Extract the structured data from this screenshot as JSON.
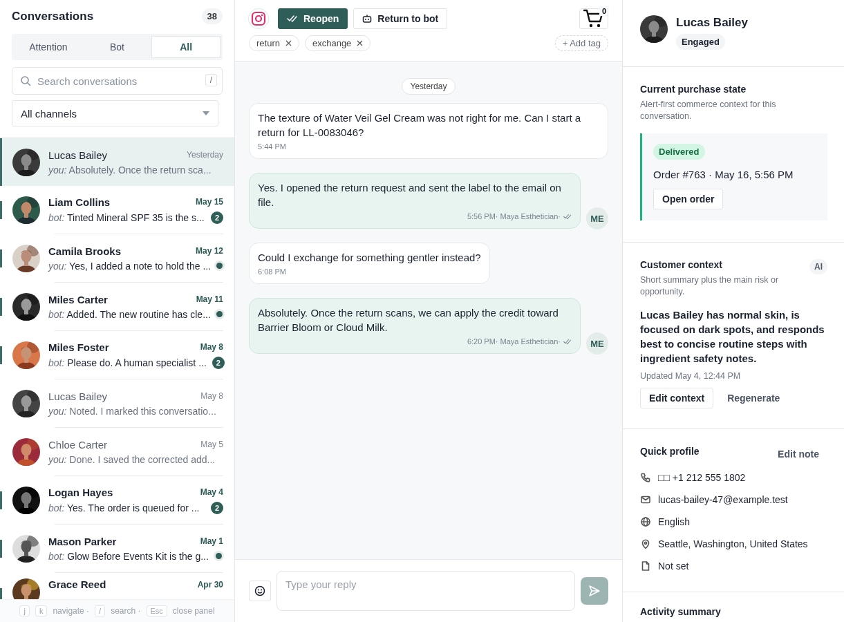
{
  "sidebar": {
    "title": "Conversations",
    "count": "38",
    "tabs": [
      {
        "label": "Attention",
        "selected": false
      },
      {
        "label": "Bot",
        "selected": false
      },
      {
        "label": "All",
        "selected": true
      }
    ],
    "search": {
      "placeholder": "Search conversations",
      "shortcut": "/"
    },
    "channel_filter": {
      "value": "All channels"
    },
    "conversations": [
      {
        "name": "Lucas Bailey",
        "date": "Yesterday",
        "sender": "you:",
        "preview": "Absolutely. Once the return sca...",
        "unread": false,
        "selected": true
      },
      {
        "name": "Liam Collins",
        "date": "May 15",
        "sender": "bot:",
        "preview": "Tinted Mineral SPF 35 is the s...",
        "unread": true,
        "selected": false,
        "indicator": {
          "kind": "count",
          "text": "2"
        }
      },
      {
        "name": "Camila Brooks",
        "date": "May 12",
        "sender": "you:",
        "preview": "Yes, I added a note to hold the ...",
        "unread": true,
        "selected": false,
        "indicator": {
          "kind": "dot"
        }
      },
      {
        "name": "Miles Carter",
        "date": "May 11",
        "sender": "bot:",
        "preview": "Added. The new routine has cle...",
        "unread": true,
        "selected": false,
        "indicator": {
          "kind": "dot"
        }
      },
      {
        "name": "Miles Foster",
        "date": "May 8",
        "sender": "bot:",
        "preview": "Please do. A human specialist ...",
        "unread": true,
        "selected": false,
        "indicator": {
          "kind": "count",
          "text": "2"
        }
      },
      {
        "name": "Lucas Bailey",
        "date": "May 8",
        "sender": "you:",
        "preview": "Noted. I marked this conversatio...",
        "unread": false,
        "selected": false
      },
      {
        "name": "Chloe Carter",
        "date": "May 5",
        "sender": "you:",
        "preview": "Done. I saved the corrected add...",
        "unread": false,
        "selected": false
      },
      {
        "name": "Logan Hayes",
        "date": "May 4",
        "sender": "bot:",
        "preview": "Yes. The order is queued for ...",
        "unread": true,
        "selected": false,
        "indicator": {
          "kind": "count",
          "text": "2"
        }
      },
      {
        "name": "Mason Parker",
        "date": "May 1",
        "sender": "bot:",
        "preview": "Glow Before Events Kit is the g...",
        "unread": true,
        "selected": false,
        "indicator": {
          "kind": "dot"
        }
      },
      {
        "name": "Grace Reed",
        "date": "Apr 30",
        "unread": true,
        "selected": false
      }
    ],
    "shortcuts": [
      {
        "kind": "key",
        "text": "j"
      },
      {
        "kind": "key",
        "text": "k"
      },
      {
        "kind": "label",
        "text": "navigate ·"
      },
      {
        "kind": "key",
        "text": "/"
      },
      {
        "kind": "label",
        "text": "search ·"
      },
      {
        "kind": "key",
        "text": "Esc"
      },
      {
        "kind": "label",
        "text": "close panel"
      }
    ]
  },
  "conversation": {
    "actions": [
      {
        "label": "Reopen",
        "kind": "primary"
      },
      {
        "label": "Return to bot",
        "kind": "secondary"
      }
    ],
    "cart_count": "0",
    "tags": [
      "return",
      "exchange"
    ],
    "add_tag": "+ Add tag",
    "day_separator": "Yesterday",
    "messages": [
      {
        "kind": "inbound",
        "text": "The texture of Water Veil Gel Cream was not right for me. Can I start a return for LL-0083046?",
        "time": "5:44 PM"
      },
      {
        "kind": "outbound",
        "text": "Yes. I opened the return request and sent the label to the email on file.",
        "meta": "5:56 PM· Maya Esthetician·",
        "avatar": "ME"
      },
      {
        "kind": "inbound",
        "text": "Could I exchange for something gentler instead?",
        "time": "6:08 PM"
      },
      {
        "kind": "outbound",
        "text": "Absolutely. Once the return scans, we can apply the credit toward Barrier Bloom or Cloud Milk.",
        "meta": "6:20 PM· Maya Esthetician·",
        "avatar": "ME"
      }
    ],
    "composer": {
      "placeholder": "Type your reply"
    }
  },
  "profile": {
    "name": "Lucas Bailey",
    "status": "Engaged",
    "purchase": {
      "title": "Current purchase state",
      "subtitle": "Alert-first commerce context for this conversation.",
      "order_status": "Delivered",
      "order": "Order #763 · May 16, 5:56 PM",
      "button": "Open order"
    },
    "context": {
      "title": "Customer context",
      "badge": "AI",
      "subtitle": "Short summary plus the main risk or opportunity.",
      "summary": "Lucas Bailey has normal skin, is focused on dark spots, and responds best to concise routine steps with ingredient safety notes.",
      "updated": "Updated May 4, 12:44 PM",
      "buttons": [
        "Edit context",
        "Regenerate"
      ]
    },
    "quick_profile": {
      "title": "Quick profile",
      "action": "Edit note",
      "fields": [
        {
          "kind": "phone",
          "value": "□□ +1 212 555 1802"
        },
        {
          "kind": "email",
          "value": "lucas-bailey-47@example.test"
        },
        {
          "kind": "language",
          "value": "English"
        },
        {
          "kind": "location",
          "value": "Seattle, Washington, United States"
        },
        {
          "kind": "note",
          "value": "Not set"
        }
      ]
    },
    "activity": {
      "title": "Activity summary"
    }
  }
}
